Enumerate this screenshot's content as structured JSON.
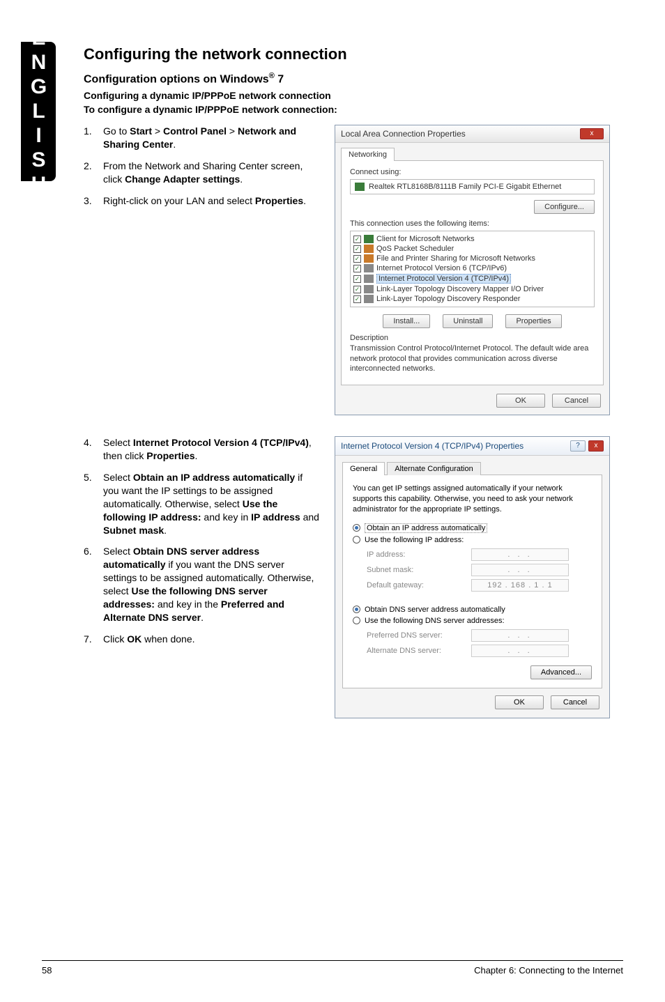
{
  "sideTab": "ENGLISH",
  "headings": {
    "sectionTitle": "Configuring the network connection",
    "subTitle_pre": "Configuration options on Windows",
    "subTitle_sup": "®",
    "subTitle_post": " 7",
    "line1": "Configuring a dynamic IP/PPPoE network connection",
    "line2": "To configure a dynamic IP/PPPoE network connection:"
  },
  "stepsA": [
    {
      "num": "1.",
      "pre": "Go to ",
      "b1": "Start",
      "mid1": " > ",
      "b2": "Control Panel",
      "mid2": " > ",
      "b3": "Network and Sharing Center",
      "post": "."
    },
    {
      "num": "2.",
      "pre": "From the Network and Sharing Center screen, click ",
      "b1": "Change Adapter settings",
      "post": "."
    },
    {
      "num": "3.",
      "pre": "Right-click on your LAN and select ",
      "b1": "Properties",
      "post": "."
    }
  ],
  "stepsB": [
    {
      "num": "4.",
      "pre": "Select ",
      "b1": "Internet Protocol Version 4 (TCP/IPv4)",
      "mid": ", then click ",
      "b2": "Properties",
      "post": "."
    },
    {
      "num": "5.",
      "pre": "Select ",
      "b1": "Obtain an IP address automatically",
      "mid": " if you want the IP settings to be assigned automatically. Otherwise, select ",
      "b2": "Use the following IP address:",
      "mid2": " and key in ",
      "b3": "IP address",
      "mid3": " and ",
      "b4": "Subnet mask",
      "post": "."
    },
    {
      "num": "6.",
      "pre": "Select ",
      "b1": "Obtain DNS server address automatically",
      "mid": " if you want the DNS server settings to be assigned automatically. Otherwise, select ",
      "b2": "Use the following DNS server addresses:",
      "mid2": " and key in the ",
      "b3": "Preferred and Alternate DNS server",
      "post": "."
    },
    {
      "num": "7.",
      "pre": "Click ",
      "b1": "OK",
      "post": " when done."
    }
  ],
  "dlg1": {
    "title": "Local Area Connection Properties",
    "close": "x",
    "tab": "Networking",
    "connectUsing": "Connect using:",
    "adapter": "Realtek RTL8168B/8111B Family PCI-E Gigabit Ethernet",
    "configure": "Configure...",
    "usesItems": "This connection uses the following items:",
    "items": [
      {
        "label": "Client for Microsoft Networks",
        "icon": "ic-green"
      },
      {
        "label": "QoS Packet Scheduler",
        "icon": "ic-orange"
      },
      {
        "label": "File and Printer Sharing for Microsoft Networks",
        "icon": "ic-orange"
      },
      {
        "label": "Internet Protocol Version 6 (TCP/IPv6)",
        "icon": "ic-gray"
      },
      {
        "label": "Internet Protocol Version 4 (TCP/IPv4)",
        "icon": "ic-gray",
        "selected": true
      },
      {
        "label": "Link-Layer Topology Discovery Mapper I/O Driver",
        "icon": "ic-gray"
      },
      {
        "label": "Link-Layer Topology Discovery Responder",
        "icon": "ic-gray"
      }
    ],
    "install": "Install...",
    "uninstall": "Uninstall",
    "properties": "Properties",
    "descLabel": "Description",
    "descText": "Transmission Control Protocol/Internet Protocol. The default wide area network protocol that provides communication across diverse interconnected networks.",
    "ok": "OK",
    "cancel": "Cancel"
  },
  "dlg2": {
    "title": "Internet Protocol Version 4 (TCP/IPv4) Properties",
    "help": "?",
    "close": "x",
    "tabGeneral": "General",
    "tabAlt": "Alternate Configuration",
    "intro": "You can get IP settings assigned automatically if your network supports this capability. Otherwise, you need to ask your network administrator for the appropriate IP settings.",
    "rObtainIP": "Obtain an IP address automatically",
    "rUseIP": "Use the following IP address:",
    "ipAddress": "IP address:",
    "subnet": "Subnet mask:",
    "gateway": "Default gateway:",
    "gatewayVal": "192 . 168 .  1  .  1",
    "dots": ".       .       .",
    "rObtainDNS": "Obtain DNS server address automatically",
    "rUseDNS": "Use the following DNS server addresses:",
    "prefDNS": "Preferred DNS server:",
    "altDNS": "Alternate DNS server:",
    "advanced": "Advanced...",
    "ok": "OK",
    "cancel": "Cancel"
  },
  "footer": {
    "pageNum": "58",
    "chapter": "Chapter 6: Connecting to the Internet"
  }
}
